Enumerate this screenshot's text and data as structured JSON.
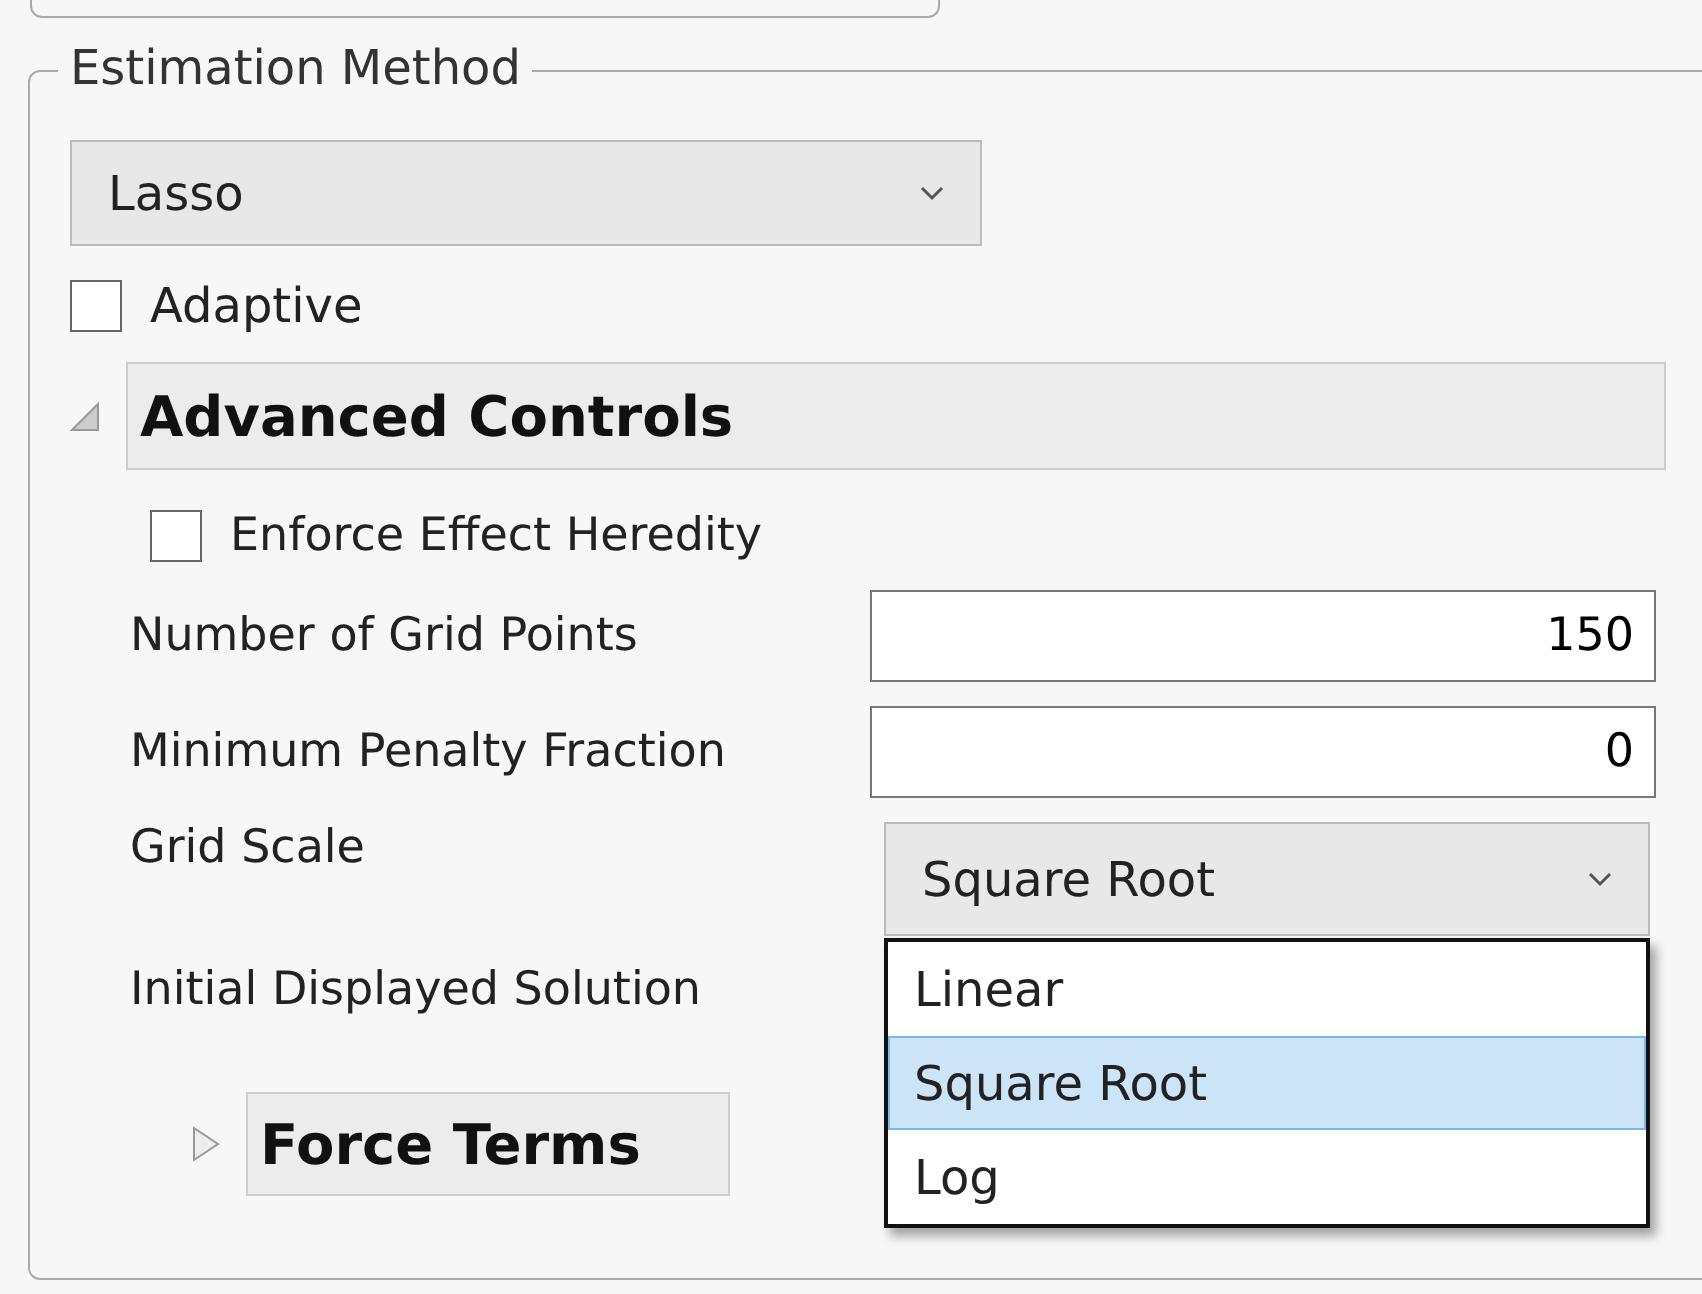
{
  "group": {
    "title": "Estimation Method"
  },
  "method": {
    "value": "Lasso"
  },
  "adaptive": {
    "label": "Adaptive",
    "checked": false
  },
  "advanced": {
    "title": "Advanced Controls",
    "expanded": true
  },
  "heredity": {
    "label": "Enforce Effect Heredity",
    "checked": false
  },
  "fields": [
    {
      "label": "Number of Grid Points",
      "value": "150"
    },
    {
      "label": "Minimum Penalty Fraction",
      "value": "0"
    }
  ],
  "grid_scale": {
    "label": "Grid Scale",
    "value": "Square Root",
    "expanded": true,
    "options": [
      {
        "label": "Linear",
        "selected": false
      },
      {
        "label": "Square Root",
        "selected": true
      },
      {
        "label": "Log",
        "selected": false
      }
    ]
  },
  "initial_solution": {
    "label": "Initial Displayed Solution"
  },
  "force_terms": {
    "title": "Force Terms",
    "expanded": false
  }
}
